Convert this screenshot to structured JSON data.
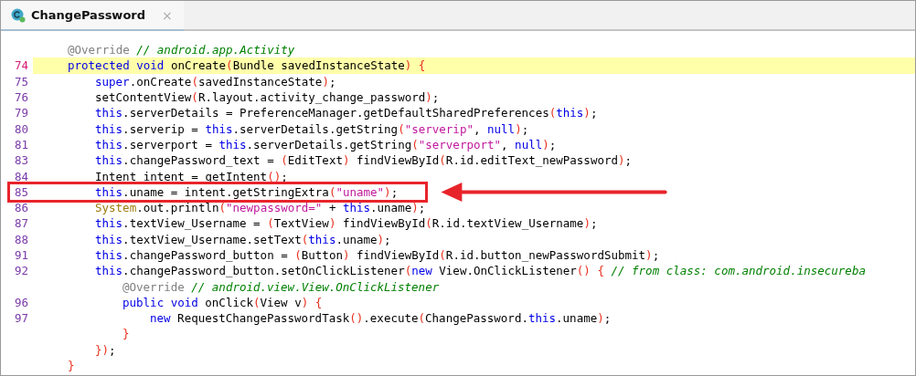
{
  "tab": {
    "title": "ChangePassword",
    "selected": true,
    "close": "×"
  },
  "lines": [
    {
      "current": false,
      "boxed": false,
      "tokens": [
        {
          "kind": "ann",
          "text": "@Override"
        },
        {
          "kind": "comment",
          "text": " // android.app.Activity"
        }
      ]
    },
    {
      "number": "74",
      "current": true,
      "boxed": false,
      "tokens": [
        {
          "kind": "kw",
          "text": "protected"
        },
        {
          "kind": "kw",
          "text": " void"
        },
        {
          "kind": "plain",
          "text": " onCreate"
        },
        {
          "kind": "paren",
          "text": "("
        },
        {
          "kind": "plain",
          "text": "Bundle savedInstanceState"
        },
        {
          "kind": "paren",
          "text": ")"
        },
        {
          "kind": "paren",
          "text": " {"
        }
      ],
      "children": [
        {
          "number": "75",
          "current": false,
          "boxed": false,
          "tokens": [
            {
              "kind": "kw",
              "text": "super"
            },
            {
              "kind": "plain",
              "text": ".onCreate"
            },
            {
              "kind": "paren",
              "text": "("
            },
            {
              "kind": "plain",
              "text": "savedInstanceState"
            },
            {
              "kind": "paren",
              "text": ")"
            },
            {
              "kind": "plain",
              "text": ";"
            }
          ]
        },
        {
          "number": "76",
          "current": false,
          "boxed": false,
          "tokens": [
            {
              "kind": "plain",
              "text": "setContentView"
            },
            {
              "kind": "paren",
              "text": "("
            },
            {
              "kind": "plain",
              "text": "R.layout.activity_change_password"
            },
            {
              "kind": "paren",
              "text": ")"
            },
            {
              "kind": "plain",
              "text": ";"
            }
          ]
        },
        {
          "number": "79",
          "current": false,
          "boxed": false,
          "tokens": [
            {
              "kind": "kw",
              "text": "this"
            },
            {
              "kind": "plain",
              "text": ".serverDetails = PreferenceManager.getDefaultSharedPreferences"
            },
            {
              "kind": "paren",
              "text": "("
            },
            {
              "kind": "kw",
              "text": "this"
            },
            {
              "kind": "paren",
              "text": ")"
            },
            {
              "kind": "plain",
              "text": ";"
            }
          ]
        },
        {
          "number": "80",
          "current": false,
          "boxed": false,
          "tokens": [
            {
              "kind": "kw",
              "text": "this"
            },
            {
              "kind": "plain",
              "text": ".serverip = "
            },
            {
              "kind": "kw",
              "text": "this"
            },
            {
              "kind": "plain",
              "text": ".serverDetails.getString"
            },
            {
              "kind": "paren",
              "text": "("
            },
            {
              "kind": "str",
              "text": "\"serverip\""
            },
            {
              "kind": "plain",
              "text": ", "
            },
            {
              "kind": "kw",
              "text": "null"
            },
            {
              "kind": "paren",
              "text": ")"
            },
            {
              "kind": "plain",
              "text": ";"
            }
          ]
        },
        {
          "number": "81",
          "current": false,
          "boxed": false,
          "tokens": [
            {
              "kind": "kw",
              "text": "this"
            },
            {
              "kind": "plain",
              "text": ".serverport = "
            },
            {
              "kind": "kw",
              "text": "this"
            },
            {
              "kind": "plain",
              "text": ".serverDetails.getString"
            },
            {
              "kind": "paren",
              "text": "("
            },
            {
              "kind": "str",
              "text": "\"serverport\""
            },
            {
              "kind": "plain",
              "text": ", "
            },
            {
              "kind": "kw",
              "text": "null"
            },
            {
              "kind": "paren",
              "text": ")"
            },
            {
              "kind": "plain",
              "text": ";"
            }
          ]
        },
        {
          "number": "83",
          "current": false,
          "boxed": false,
          "tokens": [
            {
              "kind": "kw",
              "text": "this"
            },
            {
              "kind": "plain",
              "text": ".changePassword_text = "
            },
            {
              "kind": "paren",
              "text": "("
            },
            {
              "kind": "plain",
              "text": "EditText"
            },
            {
              "kind": "paren",
              "text": ")"
            },
            {
              "kind": "plain",
              "text": " findViewById"
            },
            {
              "kind": "paren",
              "text": "("
            },
            {
              "kind": "plain",
              "text": "R.id.editText_newPassword"
            },
            {
              "kind": "paren",
              "text": ")"
            },
            {
              "kind": "plain",
              "text": ";"
            }
          ]
        },
        {
          "number": "84",
          "current": false,
          "boxed": false,
          "tokens": [
            {
              "kind": "plain",
              "text": "Intent intent = getIntent"
            },
            {
              "kind": "paren",
              "text": "()"
            },
            {
              "kind": "plain",
              "text": ";"
            }
          ]
        },
        {
          "number": "85",
          "current": false,
          "boxed": true,
          "tokens": [
            {
              "kind": "kw",
              "text": "this"
            },
            {
              "kind": "plain",
              "text": ".uname = intent.getStringExtra"
            },
            {
              "kind": "paren",
              "text": "("
            },
            {
              "kind": "str",
              "text": "\"uname\""
            },
            {
              "kind": "paren",
              "text": ")"
            },
            {
              "kind": "plain",
              "text": ";"
            }
          ]
        },
        {
          "number": "86",
          "current": false,
          "boxed": false,
          "tokens": [
            {
              "kind": "sys",
              "text": "System"
            },
            {
              "kind": "plain",
              "text": ".out.println"
            },
            {
              "kind": "paren",
              "text": "("
            },
            {
              "kind": "str",
              "text": "\"newpassword=\""
            },
            {
              "kind": "plain",
              "text": " + "
            },
            {
              "kind": "kw",
              "text": "this"
            },
            {
              "kind": "plain",
              "text": ".uname"
            },
            {
              "kind": "paren",
              "text": ")"
            },
            {
              "kind": "plain",
              "text": ";"
            }
          ]
        },
        {
          "number": "87",
          "current": false,
          "boxed": false,
          "tokens": [
            {
              "kind": "kw",
              "text": "this"
            },
            {
              "kind": "plain",
              "text": ".textView_Username = "
            },
            {
              "kind": "paren",
              "text": "("
            },
            {
              "kind": "plain",
              "text": "TextView"
            },
            {
              "kind": "paren",
              "text": ")"
            },
            {
              "kind": "plain",
              "text": " findViewById"
            },
            {
              "kind": "paren",
              "text": "("
            },
            {
              "kind": "plain",
              "text": "R.id.textView_Username"
            },
            {
              "kind": "paren",
              "text": ")"
            },
            {
              "kind": "plain",
              "text": ";"
            }
          ]
        },
        {
          "number": "88",
          "current": false,
          "boxed": false,
          "tokens": [
            {
              "kind": "kw",
              "text": "this"
            },
            {
              "kind": "plain",
              "text": ".textView_Username.setText"
            },
            {
              "kind": "paren",
              "text": "("
            },
            {
              "kind": "kw",
              "text": "this"
            },
            {
              "kind": "plain",
              "text": ".uname"
            },
            {
              "kind": "paren",
              "text": ")"
            },
            {
              "kind": "plain",
              "text": ";"
            }
          ]
        },
        {
          "number": "91",
          "current": false,
          "boxed": false,
          "tokens": [
            {
              "kind": "kw",
              "text": "this"
            },
            {
              "kind": "plain",
              "text": ".changePassword_button = "
            },
            {
              "kind": "paren",
              "text": "("
            },
            {
              "kind": "plain",
              "text": "Button"
            },
            {
              "kind": "paren",
              "text": ")"
            },
            {
              "kind": "plain",
              "text": " findViewById"
            },
            {
              "kind": "paren",
              "text": "("
            },
            {
              "kind": "plain",
              "text": "R.id.button_newPasswordSubmit"
            },
            {
              "kind": "paren",
              "text": ")"
            },
            {
              "kind": "plain",
              "text": ";"
            }
          ]
        },
        {
          "number": "92",
          "current": false,
          "boxed": false,
          "tokens": [
            {
              "kind": "kw",
              "text": "this"
            },
            {
              "kind": "plain",
              "text": ".changePassword_button.setOnClickListener"
            },
            {
              "kind": "paren",
              "text": "("
            },
            {
              "kind": "kw",
              "text": "new"
            },
            {
              "kind": "plain",
              "text": " View.OnClickListener"
            },
            {
              "kind": "paren",
              "text": "()"
            },
            {
              "kind": "paren",
              "text": " {"
            },
            {
              "kind": "comment",
              "text": " // from class: com.android.insecureba"
            }
          ],
          "children": [
            {
              "current": false,
              "boxed": false,
              "tokens": [
                {
                  "kind": "ann",
                  "text": "@Override"
                },
                {
                  "kind": "comment",
                  "text": " // android.view.View.OnClickListener"
                }
              ]
            },
            {
              "number": "96",
              "current": false,
              "boxed": false,
              "tokens": [
                {
                  "kind": "kw",
                  "text": "public"
                },
                {
                  "kind": "kw",
                  "text": " void"
                },
                {
                  "kind": "plain",
                  "text": " onClick"
                },
                {
                  "kind": "paren",
                  "text": "("
                },
                {
                  "kind": "plain",
                  "text": "View v"
                },
                {
                  "kind": "paren",
                  "text": ")"
                },
                {
                  "kind": "paren",
                  "text": " {"
                }
              ],
              "children": [
                {
                  "number": "97",
                  "current": false,
                  "boxed": false,
                  "tokens": [
                    {
                      "kind": "kw",
                      "text": "new"
                    },
                    {
                      "kind": "plain",
                      "text": " RequestChangePasswordTask"
                    },
                    {
                      "kind": "paren",
                      "text": "()"
                    },
                    {
                      "kind": "plain",
                      "text": ".execute"
                    },
                    {
                      "kind": "paren",
                      "text": "("
                    },
                    {
                      "kind": "plain",
                      "text": "ChangePassword."
                    },
                    {
                      "kind": "kw",
                      "text": "this"
                    },
                    {
                      "kind": "plain",
                      "text": ".uname"
                    },
                    {
                      "kind": "paren",
                      "text": ")"
                    },
                    {
                      "kind": "plain",
                      "text": ";"
                    }
                  ]
                }
              ]
            },
            {
              "current": false,
              "boxed": false,
              "tokens": [
                {
                  "kind": "paren",
                  "text": "}"
                }
              ]
            }
          ]
        },
        {
          "current": false,
          "boxed": false,
          "tokens": [
            {
              "kind": "paren",
              "text": "})"
            },
            {
              "kind": "plain",
              "text": ";"
            }
          ]
        }
      ]
    },
    {
      "current": false,
      "boxed": false,
      "tokens": [
        {
          "kind": "paren",
          "text": "}"
        }
      ]
    }
  ]
}
